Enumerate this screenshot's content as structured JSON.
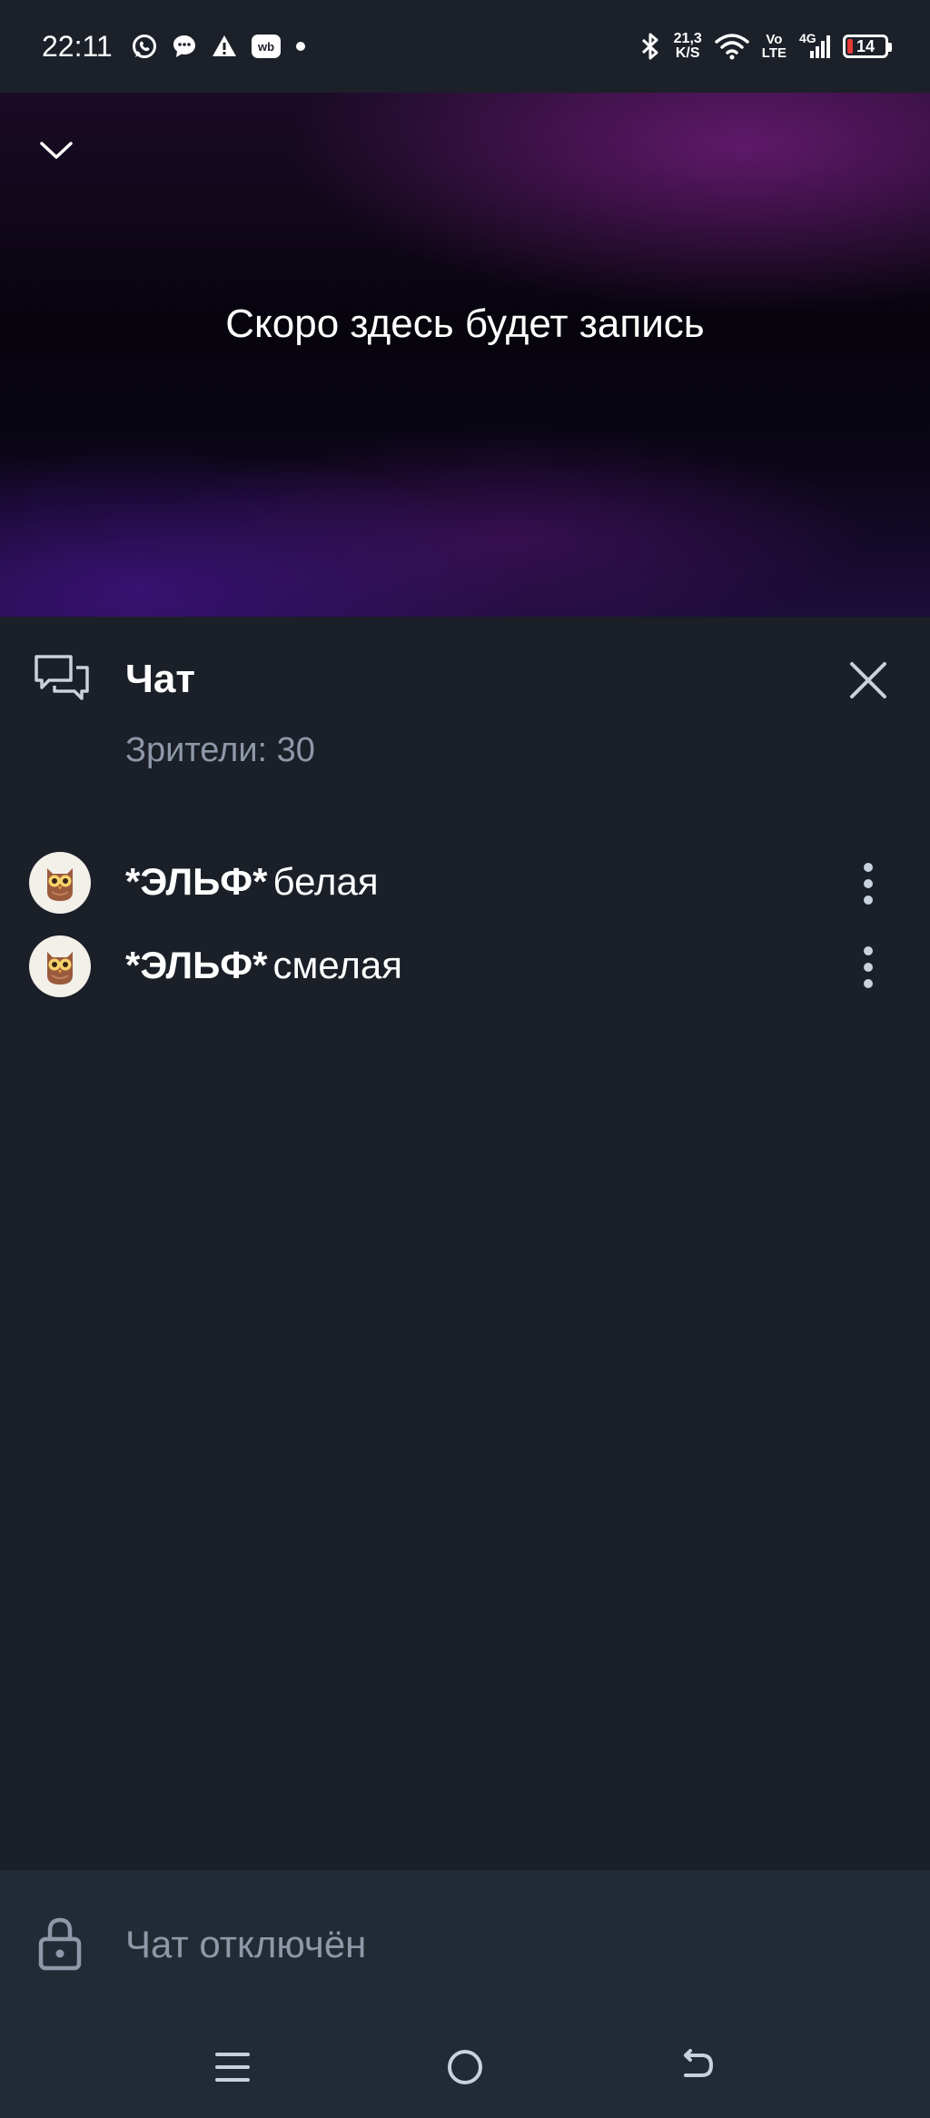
{
  "status_bar": {
    "time": "22:11",
    "net_speed_value": "21,3",
    "net_speed_unit": "K/S",
    "volte_top": "Vo",
    "volte_bottom": "LTE",
    "network": "4G",
    "battery": "14",
    "battery_level": 0.14,
    "left_icons": [
      "whatsapp-icon",
      "message-icon",
      "alert-icon",
      "wb-icon",
      "dot-icon"
    ],
    "right_icons": [
      "bluetooth-icon",
      "wifi-icon",
      "signal-icon",
      "battery-icon"
    ],
    "wb_text": "wb"
  },
  "video": {
    "placeholder_text": "Скоро здесь будет запись"
  },
  "chat": {
    "title": "Чат",
    "viewers_label": "Зрители: 30",
    "messages": [
      {
        "author": "*ЭЛЬФ*",
        "text": "белая"
      },
      {
        "author": "*ЭЛЬФ*",
        "text": "смелая"
      }
    ],
    "disabled_text": "Чат отключён"
  },
  "colors": {
    "background": "#1a1f28",
    "secondary_text": "#8e98a8",
    "bottom_bar": "#222b35",
    "battery_low": "#e53935"
  }
}
